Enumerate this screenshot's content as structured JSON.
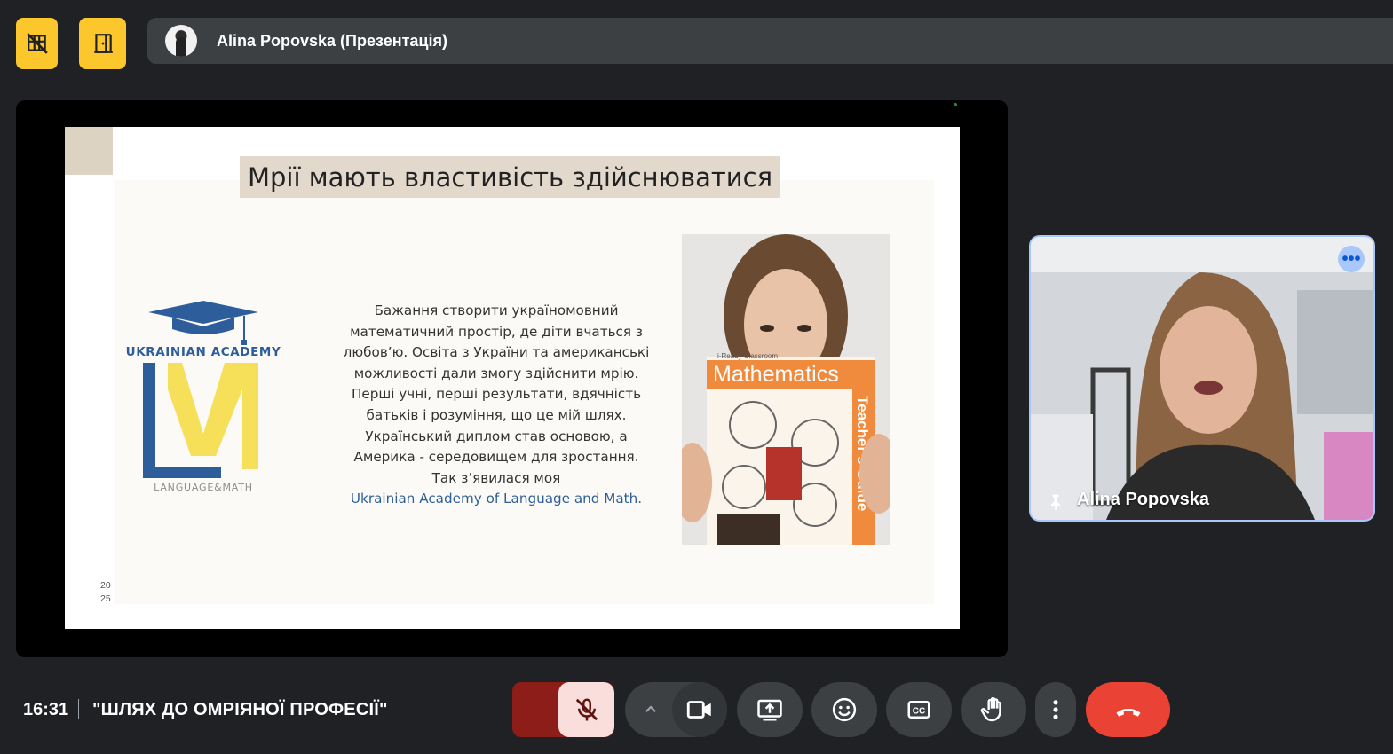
{
  "header": {
    "presenter_label": "Alina Popovska (Презентація)"
  },
  "icons": {
    "top_left": "visibility-off-grid-icon",
    "top_second": "door-exit-icon",
    "mic": "mic-off-icon",
    "camera": "videocam-icon",
    "present": "present-to-all-icon",
    "emoji": "emoji-icon",
    "captions": "closed-captions-icon",
    "hand": "raise-hand-icon",
    "more": "more-vert-icon",
    "end_call": "call-end-icon",
    "pin": "pin-icon"
  },
  "slide": {
    "title": "Мрії мають властивість здійснюватися",
    "logo_text": "UKRAINIAN ACADEMY",
    "logo_sub": "LANGUAGE&MATH",
    "body_lines": [
      "Бажання створити україномовний",
      "математичний простір, де діти вчаться з",
      "любов’ю. Освіта з України та американські",
      "можливості дали змогу здійснити мрію.",
      "Перші учні, перші результати, вдячність",
      "батьків і розуміння, що це мій шлях.",
      "Український диплом став основою, а",
      "Америка - середовищем для зростання.",
      "Так з’явилася моя"
    ],
    "link_text": "Ukrainian Academy of Language and Math.",
    "book_title": "Mathematics",
    "book_brand": "i-Ready Classroom",
    "book_side": "Teacher's Guide",
    "year_top": "20",
    "year_bottom": "25"
  },
  "participant": {
    "name": "Alina Popovska",
    "more_label": "•••"
  },
  "footer": {
    "time": "16:31",
    "meeting_title": "\"ШЛЯХ ДО ОМРІЯНОЇ ПРОФЕСІЇ\""
  },
  "colors": {
    "background": "#202124",
    "accent_yellow": "#fcc62d",
    "end_call": "#ea4335",
    "mic_off_bg": "#f9dedc",
    "mic_menu_bg": "#8c1d18",
    "control_bg": "#3c4043",
    "tile_border": "#a8c7fa"
  }
}
